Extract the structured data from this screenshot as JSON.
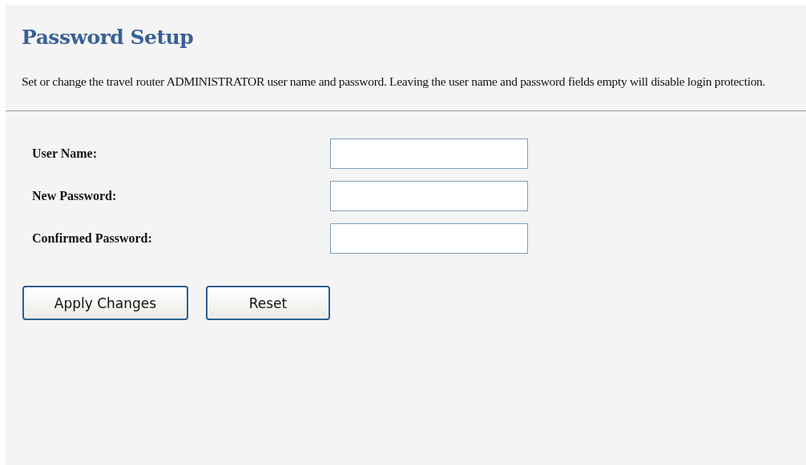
{
  "title": "Password Setup",
  "description": "Set or change the travel router ADMINISTRATOR user name and password. Leaving the user name and password fields empty will disable login protection.",
  "fields": [
    {
      "label": "User Name:"
    },
    {
      "label": "New Password:"
    },
    {
      "label": "Confirmed Password:"
    }
  ],
  "buttons": [
    "Apply Changes",
    "Reset"
  ]
}
